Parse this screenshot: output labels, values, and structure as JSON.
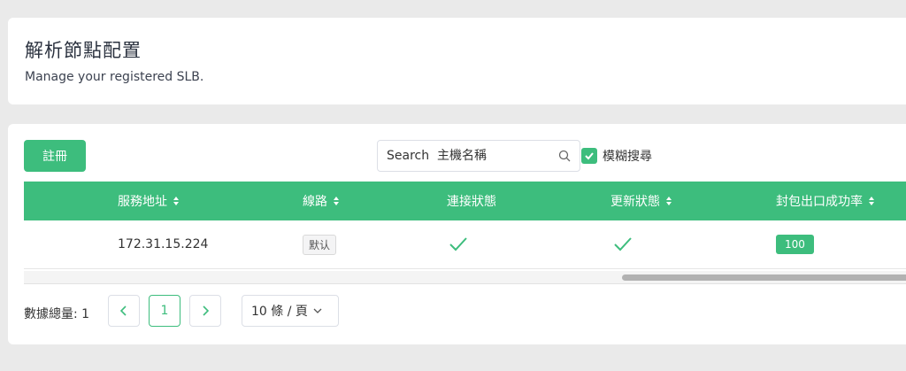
{
  "header": {
    "title": "解析節點配置",
    "subtitle": "Manage your registered SLB."
  },
  "toolbar": {
    "register_label": "註冊",
    "search_placeholder": "Search  主機名稱",
    "fuzzy_label": "模糊搜尋",
    "fuzzy_checked": true
  },
  "table": {
    "columns": [
      "服務地址",
      "線路",
      "連接狀態",
      "更新狀態",
      "封包出口成功率"
    ],
    "rows": [
      {
        "address": "172.31.15.224",
        "line": "默认",
        "connect_ok": true,
        "update_ok": true,
        "success_rate": "100"
      }
    ]
  },
  "pagination": {
    "total_label": "數據總量: 1",
    "current_page": "1",
    "page_size_label": "10 條 / 頁"
  },
  "colors": {
    "accent": "#3dbd7d",
    "background": "#eaeaea"
  }
}
